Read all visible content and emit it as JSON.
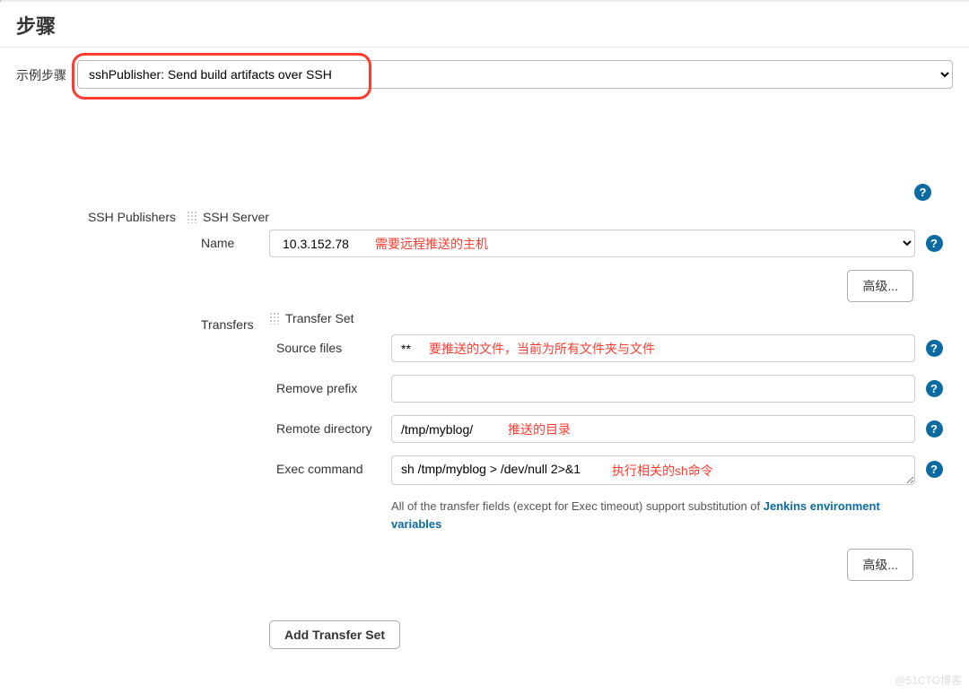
{
  "page": {
    "title": "步骤"
  },
  "example_step": {
    "label": "示例步骤",
    "value": "sshPublisher: Send build artifacts over SSH"
  },
  "ssh": {
    "publishers_label": "SSH Publishers",
    "server_label": "SSH Server",
    "name_label": "Name",
    "name_value": "10.3.152.78",
    "advanced_btn": "高级...",
    "transfers_label": "Transfers",
    "transfer_set_label": "Transfer Set",
    "source_label": "Source files",
    "source_value": "**",
    "remove_prefix_label": "Remove prefix",
    "remove_prefix_value": "",
    "remote_dir_label": "Remote directory",
    "remote_dir_value": "/tmp/myblog/",
    "exec_label": "Exec command",
    "exec_value": "sh /tmp/myblog > /dev/null 2>&1",
    "hint_prefix": "All of the transfer fields (except for Exec timeout) support substitution of ",
    "hint_link": "Jenkins environment variables",
    "advanced2_btn": "高级...",
    "add_transfer_btn": "Add Transfer Set"
  },
  "annotations": {
    "host": "需要远程推送的主机",
    "files": "要推送的文件，当前为所有文件夹与文件",
    "dir": "推送的目录",
    "cmd": "执行相关的sh命令"
  },
  "watermark": "@51CTO博客"
}
